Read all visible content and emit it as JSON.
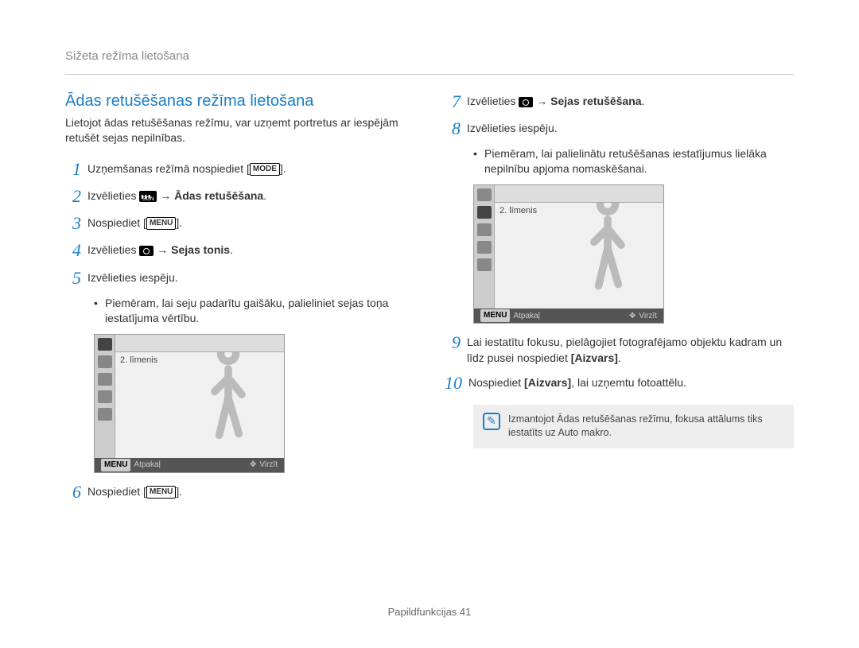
{
  "header": {
    "title": "Sižeta režīma lietošana"
  },
  "left": {
    "section_title": "Ādas retušēšanas režīma lietošana",
    "intro": "Lietojot ādas retušēšanas režīmu, var uzņemt portretus ar iespējām retušēt sejas nepilnības.",
    "step1_a": "Uzņemšanas režīmā nospiediet ",
    "step1_mode": "MODE",
    "step2_a": "Izvēlieties ",
    "step2_b": " → Ādas retušēšana",
    "step3_a": "Nospiediet ",
    "step3_menu": "MENU",
    "step4_a": "Izvēlieties ",
    "step4_b": " → Sejas tonis",
    "step5": "Izvēlieties iespēju.",
    "step5_sub": "Piemēram, lai seju padarītu gaišāku, palieliniet sejas toņa iestatījuma vērtību.",
    "step6_a": "Nospiediet ",
    "step6_menu": "MENU"
  },
  "right": {
    "step7_a": "Izvēlieties ",
    "step7_b": " → Sejas retušēšana",
    "step8": "Izvēlieties iespēju.",
    "step8_sub": "Piemēram, lai palielinātu retušēšanas iestatījumus lielāka nepilnību apjoma nomaskēšanai.",
    "step9": "Lai iestatītu fokusu, pielāgojiet fotografējamo objektu kadram un līdz pusei nospiediet ",
    "step9_b": "[Aizvars]",
    "step10_a": "Nospiediet ",
    "step10_b": "[Aizvars]",
    "step10_c": ", lai uzņemtu fotoattēlu.",
    "note": "Izmantojot Ādas retušēšanas režīmu, fokusa attālums tiks iestatīts uz Auto makro."
  },
  "screenshot": {
    "toolbar_icons": "✶ ✶ ✶ ✶",
    "level": "2. līmenis",
    "footer_left_label": "MENU",
    "footer_left_text": "Atpakaļ",
    "footer_right_text": "Virzīt"
  },
  "footer": {
    "text": "Papildfunkcijas  41"
  },
  "steps": {
    "n1": "1",
    "n2": "2",
    "n3": "3",
    "n4": "4",
    "n5": "5",
    "n6": "6",
    "n7": "7",
    "n8": "8",
    "n9": "9",
    "n10": "10"
  },
  "scn_label": "SCN"
}
